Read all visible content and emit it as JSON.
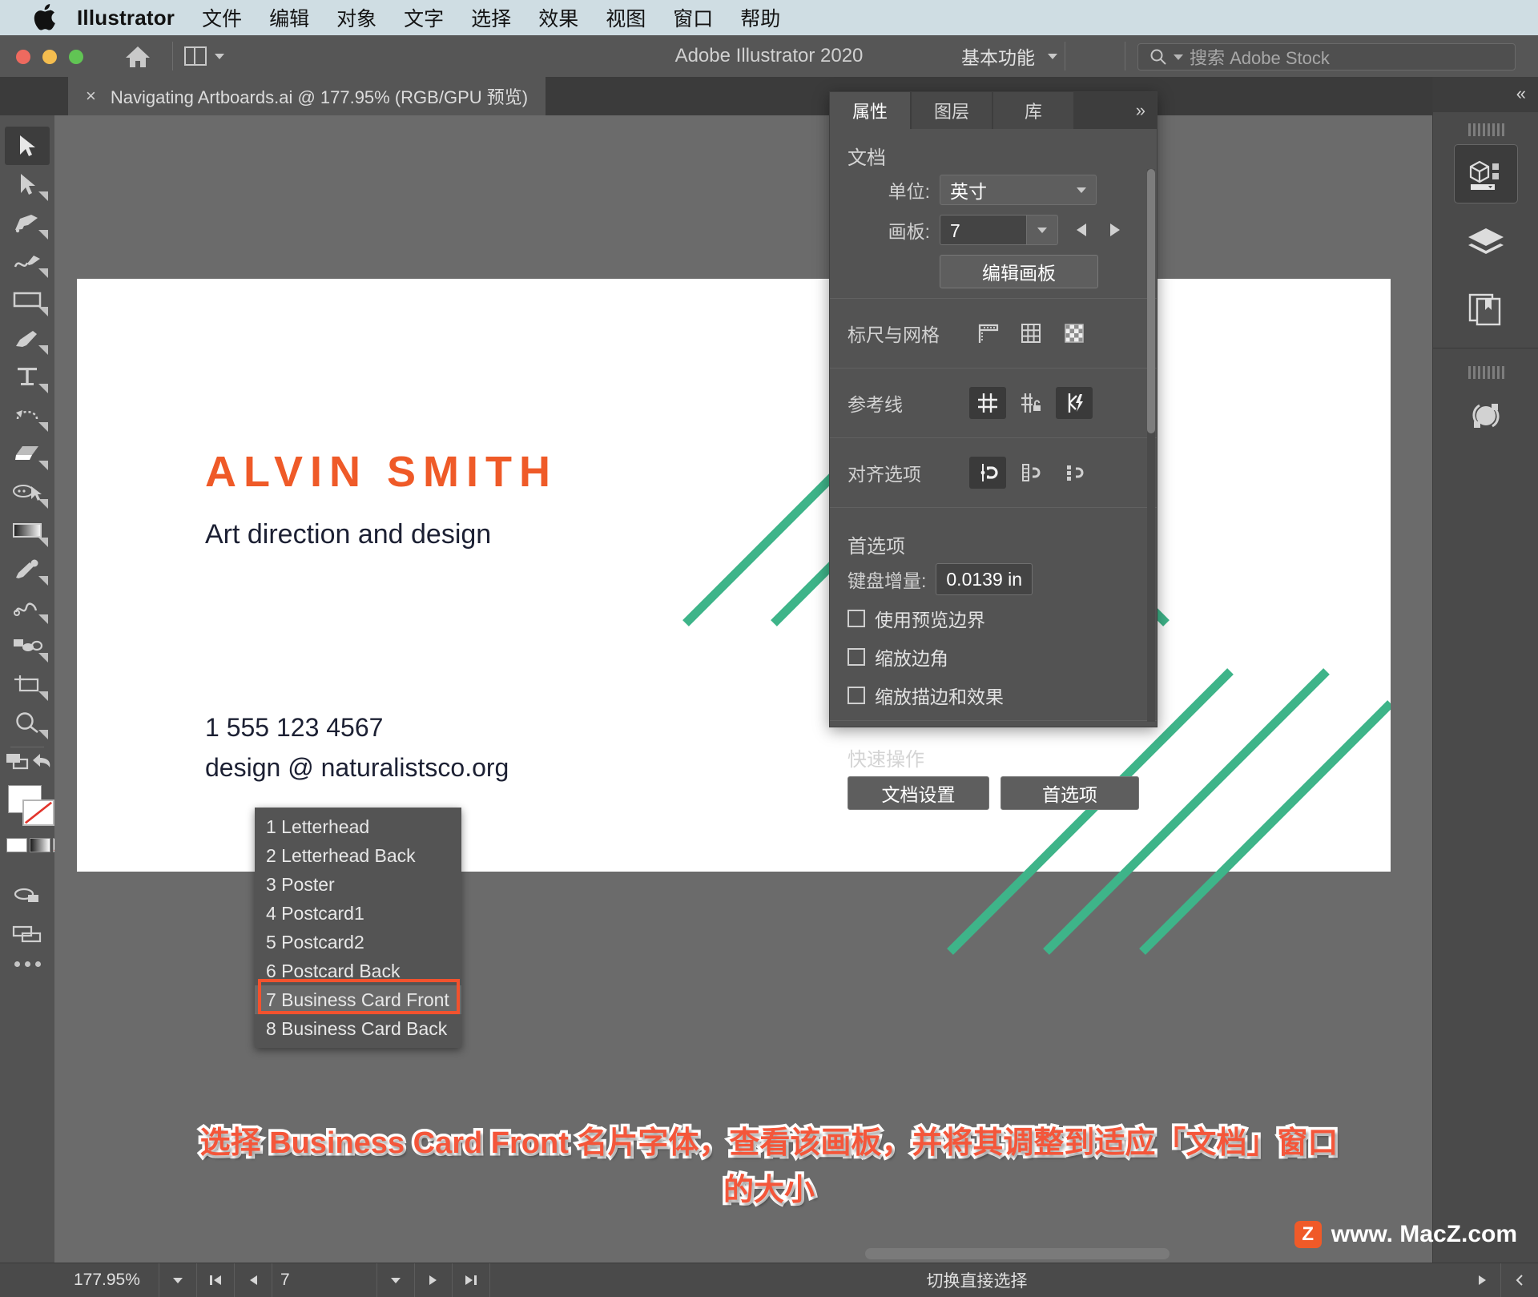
{
  "macmenu": {
    "app_name": "Illustrator",
    "items": [
      "文件",
      "编辑",
      "对象",
      "文字",
      "选择",
      "效果",
      "视图",
      "窗口",
      "帮助"
    ]
  },
  "titlebar": {
    "title": "Adobe Illustrator 2020",
    "workspace": "基本功能",
    "search_placeholder": "搜索 Adobe Stock"
  },
  "tab": {
    "close": "×",
    "label": "Navigating Artboards.ai @ 177.95% (RGB/GPU 预览)"
  },
  "panel": {
    "tabs": [
      {
        "label": "属性",
        "active": true
      },
      {
        "label": "图层",
        "active": false
      },
      {
        "label": "库",
        "active": false
      }
    ],
    "more": "»",
    "document": {
      "title": "文档",
      "unit_label": "单位:",
      "unit_value": "英寸",
      "artboard_label": "画板:",
      "artboard_value": "7",
      "edit_artboard_button": "编辑画板"
    },
    "rulers": {
      "label": "标尺与网格",
      "icons": [
        "ruler-icon",
        "grid-icon",
        "transparency-grid-icon"
      ]
    },
    "guides": {
      "label": "参考线",
      "icons": [
        "show-guides-icon",
        "lock-guides-icon",
        "smart-guides-icon"
      ]
    },
    "align": {
      "label": "对齐选项",
      "icons": [
        "snap-to-point-icon",
        "snap-to-pixel-icon",
        "snap-to-grid-icon"
      ]
    },
    "preferences": {
      "title": "首选项",
      "keyboard_increment_label": "键盘增量:",
      "keyboard_increment_value": "0.0139 in",
      "checkboxes": [
        {
          "label": "使用预览边界",
          "checked": false
        },
        {
          "label": "缩放边角",
          "checked": false
        },
        {
          "label": "缩放描边和效果",
          "checked": false
        }
      ]
    },
    "quick_actions": {
      "title": "快速操作",
      "buttons": [
        "文档设置",
        "首选项"
      ]
    }
  },
  "artboard_menu": {
    "items": [
      {
        "label": "1 Letterhead",
        "selected": false
      },
      {
        "label": "2 Letterhead Back",
        "selected": false
      },
      {
        "label": "3 Poster",
        "selected": false
      },
      {
        "label": "4 Postcard1",
        "selected": false
      },
      {
        "label": "5 Postcard2",
        "selected": false
      },
      {
        "label": "6 Postcard Back",
        "selected": false
      },
      {
        "label": "7 Business Card Front",
        "selected": true
      },
      {
        "label": "8 Business Card Back",
        "selected": false
      }
    ]
  },
  "business_card": {
    "name": "ALVIN SMITH",
    "role": "Art direction and design",
    "phone": "1 555 123 4567",
    "email": "design @ naturalistsco.org",
    "accent_color": "#EF5A28",
    "chevron_color": "#3EB489"
  },
  "statusbar": {
    "zoom": "177.95%",
    "page": "7",
    "status_text": "切换直接选择"
  },
  "annotation": {
    "line1": "选择 Business Card Front 名片字体，查看该画板，并将其调整到适应「文档」窗口",
    "line2": "的大小",
    "color": "#F4563A"
  },
  "watermark": {
    "badge": "Z",
    "text": "www. MacZ.com"
  },
  "rail": {
    "collapse": "«",
    "items": [
      "3d-properties-icon",
      "layers-icon",
      "libraries-icon",
      "cc-sync-icon"
    ]
  },
  "tools": [
    {
      "name": "selection-tool",
      "selected": true
    },
    {
      "name": "direct-selection-tool",
      "selected": false
    },
    {
      "name": "pen-tool",
      "selected": false
    },
    {
      "name": "curvature-tool",
      "selected": false
    },
    {
      "name": "rectangle-tool",
      "selected": false
    },
    {
      "name": "paintbrush-tool",
      "selected": false
    },
    {
      "name": "type-tool",
      "selected": false
    },
    {
      "name": "rotate-tool",
      "selected": false
    },
    {
      "name": "eraser-tool",
      "selected": false
    },
    {
      "name": "shape-builder-tool",
      "selected": false
    },
    {
      "name": "gradient-tool",
      "selected": false
    },
    {
      "name": "eyedropper-tool",
      "selected": false
    },
    {
      "name": "blend-tool",
      "selected": false
    },
    {
      "name": "symbol-sprayer-tool",
      "selected": false
    },
    {
      "name": "artboard-tool",
      "selected": false
    },
    {
      "name": "zoom-tool",
      "selected": false
    }
  ]
}
